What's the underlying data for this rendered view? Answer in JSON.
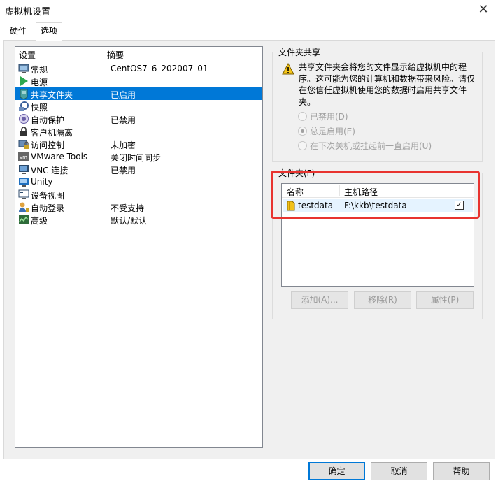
{
  "window": {
    "title": "虚拟机设置"
  },
  "tabs": [
    {
      "label": "硬件"
    },
    {
      "label": "选项"
    }
  ],
  "settings_list": {
    "header_setting": "设置",
    "header_summary": "摘要",
    "items": [
      {
        "label": "常规",
        "summary": "CentOS7_6_202007_01",
        "icon": "general-icon"
      },
      {
        "label": "电源",
        "summary": "",
        "icon": "power-icon"
      },
      {
        "label": "共享文件夹",
        "summary": "已启用",
        "icon": "shared-folder-icon",
        "selected": true
      },
      {
        "label": "快照",
        "summary": "",
        "icon": "snapshot-icon"
      },
      {
        "label": "自动保护",
        "summary": "已禁用",
        "icon": "autoprotect-icon"
      },
      {
        "label": "客户机隔离",
        "summary": "",
        "icon": "guest-isolation-icon"
      },
      {
        "label": "访问控制",
        "summary": "未加密",
        "icon": "access-control-icon"
      },
      {
        "label": "VMware Tools",
        "summary": "关闭时间同步",
        "icon": "vmware-tools-icon"
      },
      {
        "label": "VNC 连接",
        "summary": "已禁用",
        "icon": "vnc-icon"
      },
      {
        "label": "Unity",
        "summary": "",
        "icon": "unity-icon"
      },
      {
        "label": "设备视图",
        "summary": "",
        "icon": "device-view-icon"
      },
      {
        "label": "自动登录",
        "summary": "不受支持",
        "icon": "autologin-icon"
      },
      {
        "label": "高级",
        "summary": "默认/默认",
        "icon": "advanced-icon"
      }
    ]
  },
  "folder_sharing": {
    "title": "文件夹共享",
    "warning": "共享文件夹会将您的文件显示给虚拟机中的程序。这可能为您的计算机和数据带来风险。请仅在您信任虚拟机使用您的数据时启用共享文件夹。",
    "options": [
      {
        "label": "已禁用(D)",
        "checked": false
      },
      {
        "label": "总是启用(E)",
        "checked": true
      },
      {
        "label": "在下次关机或挂起前一直启用(U)",
        "checked": false
      }
    ]
  },
  "folders": {
    "title": "文件夹(F)",
    "col_name": "名称",
    "col_path": "主机路径",
    "rows": [
      {
        "name": "testdata",
        "path": "F:\\kkb\\testdata",
        "enabled": true
      }
    ],
    "add_label": "添加(A)...",
    "remove_label": "移除(R)",
    "props_label": "属性(P)"
  },
  "buttons": {
    "ok": "确定",
    "cancel": "取消",
    "help": "帮助"
  },
  "colors": {
    "selection": "#0078d7",
    "highlight_box": "#e8332f"
  }
}
